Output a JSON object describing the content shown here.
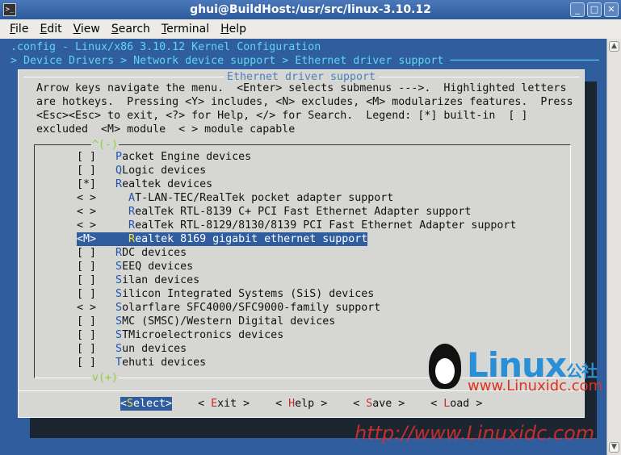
{
  "window": {
    "title": "ghui@BuildHost:/usr/src/linux-3.10.12",
    "icon": "terminal-icon",
    "controls": [
      "minimize",
      "maximize",
      "close"
    ]
  },
  "menubar": [
    {
      "hk": "F",
      "rest": "ile"
    },
    {
      "hk": "E",
      "rest": "dit"
    },
    {
      "hk": "V",
      "rest": "iew"
    },
    {
      "hk": "S",
      "rest": "earch"
    },
    {
      "hk": "T",
      "rest": "erminal"
    },
    {
      "hk": "H",
      "rest": "elp"
    }
  ],
  "terminal": {
    "config_line": ".config - Linux/x86 3.10.12 Kernel Configuration",
    "breadcrumb": "> Device Drivers > Network device support > Ethernet driver support ───────────────────────",
    "dialog_title": "Ethernet driver support",
    "help_text": "Arrow keys navigate the menu.  <Enter> selects submenus --->.  Highlighted letters\nare hotkeys.  Pressing <Y> includes, <N> excludes, <M> modularizes features.  Press\n<Esc><Esc> to exit, <?> for Help, </> for Search.  Legend: [*] built-in  [ ]\nexcluded  <M> module  < > module capable",
    "scroll_up": "^(-)",
    "scroll_down": "v(+)",
    "items": [
      {
        "prefix": "[ ]   ",
        "hk": "P",
        "rest": "acket Engine devices"
      },
      {
        "prefix": "[ ]   ",
        "hk": "Q",
        "rest": "Logic devices"
      },
      {
        "prefix": "[*]   ",
        "hk": "R",
        "rest": "ealtek devices"
      },
      {
        "prefix": "< >     ",
        "hk": "A",
        "rest": "T-LAN-TEC/RealTek pocket adapter support"
      },
      {
        "prefix": "< >     ",
        "hk": "R",
        "rest": "ealTek RTL-8139 C+ PCI Fast Ethernet Adapter support"
      },
      {
        "prefix": "< >     ",
        "hk": "R",
        "rest": "ealTek RTL-8129/8130/8139 PCI Fast Ethernet Adapter support"
      },
      {
        "prefix": "<M>     ",
        "hk": "R",
        "rest": "ealtek 8169 gigabit ethernet support",
        "selected": true
      },
      {
        "prefix": "[ ]   ",
        "hk": "R",
        "rest": "DC devices"
      },
      {
        "prefix": "[ ]   ",
        "hk": "S",
        "rest": "EEQ devices"
      },
      {
        "prefix": "[ ]   ",
        "hk": "S",
        "rest": "ilan devices"
      },
      {
        "prefix": "[ ]   ",
        "hk": "S",
        "rest": "ilicon Integrated Systems (SiS) devices"
      },
      {
        "prefix": "< >   ",
        "hk": "S",
        "rest": "olarflare SFC4000/SFC9000-family support"
      },
      {
        "prefix": "[ ]   ",
        "hk": "S",
        "rest": "MC (SMSC)/Western Digital devices"
      },
      {
        "prefix": "[ ]   ",
        "hk": "S",
        "rest": "TMicroelectronics devices"
      },
      {
        "prefix": "[ ]   ",
        "hk": "S",
        "rest": "un devices"
      },
      {
        "prefix": "[ ]   ",
        "hk": "T",
        "rest": "ehuti devices"
      }
    ],
    "buttons": [
      {
        "pre": "<",
        "hk": "S",
        "rest": "elect>",
        "selected": true
      },
      {
        "pre": "< ",
        "hk": "E",
        "rest": "xit >"
      },
      {
        "pre": "< ",
        "hk": "H",
        "rest": "elp >"
      },
      {
        "pre": "< ",
        "hk": "S",
        "rest": "ave >"
      },
      {
        "pre": "< ",
        "hk": "L",
        "rest": "oad >"
      }
    ]
  },
  "watermark": {
    "logo": "Linux公社",
    "url": "www.Linuxidc.com",
    "url2": "http://www.Linuxidc.com"
  },
  "colors": {
    "terminal_bg": "#2f5d9e",
    "dialog_bg": "#d6d6d2",
    "text_cyan": "#5fd7ee",
    "hotkey_red": "#c03030"
  }
}
